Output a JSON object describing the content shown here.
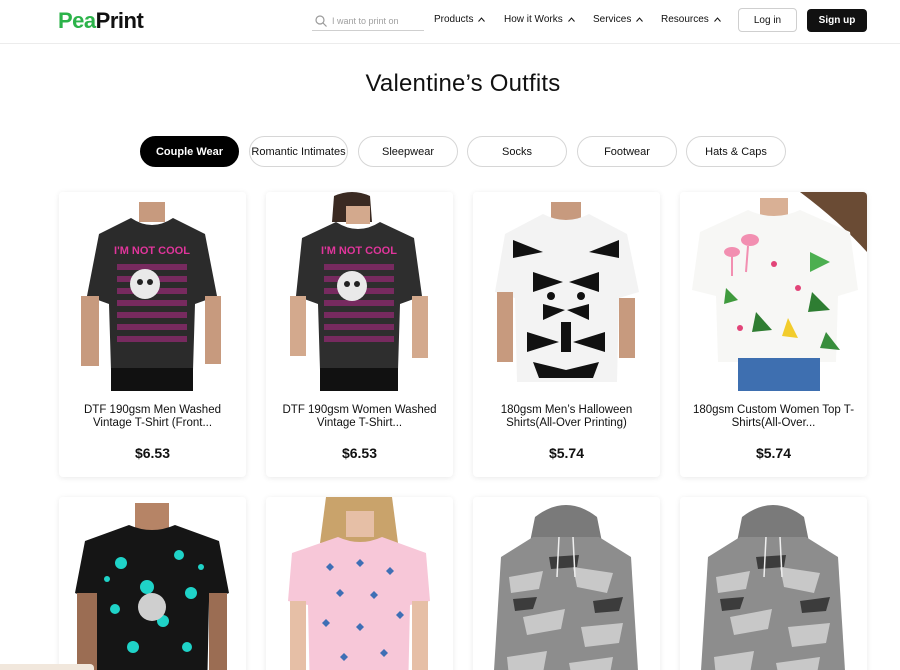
{
  "brand": {
    "logo_pea": "Pea",
    "logo_print": "Print"
  },
  "search": {
    "placeholder": "I want to print on"
  },
  "nav": {
    "products": "Products",
    "how_it_works": "How it Works",
    "services": "Services",
    "resources": "Resources"
  },
  "auth": {
    "login": "Log in",
    "signup": "Sign up"
  },
  "page": {
    "title": "Valentine’s Outfits"
  },
  "tabs": [
    {
      "label": "Couple Wear",
      "active": true
    },
    {
      "label": "Romantic Intimates",
      "active": false
    },
    {
      "label": "Sleepwear",
      "active": false
    },
    {
      "label": "Socks",
      "active": false
    },
    {
      "label": "Footwear",
      "active": false
    },
    {
      "label": "Hats & Caps",
      "active": false
    }
  ],
  "products": [
    {
      "name": "DTF 190gsm Men Washed Vintage T-Shirt (Front...",
      "price": "$6.53",
      "image_text": "I'M NOT COOL"
    },
    {
      "name": "DTF 190gsm Women Washed Vintage T-Shirt...",
      "price": "$6.53",
      "image_text": "I'M NOT COOL"
    },
    {
      "name": "180gsm Men’s Halloween Shirts(All-Over Printing)",
      "price": "$5.74"
    },
    {
      "name": "180gsm Custom Women Top T-Shirts(All-Over...",
      "price": "$5.74"
    },
    {
      "name": "",
      "price": ""
    },
    {
      "name": "",
      "price": ""
    },
    {
      "name": "",
      "price": ""
    },
    {
      "name": "",
      "price": ""
    }
  ],
  "colors": {
    "brand_green": "#2cb34a",
    "accent_black": "#111111",
    "print_pink": "#e0359b"
  }
}
